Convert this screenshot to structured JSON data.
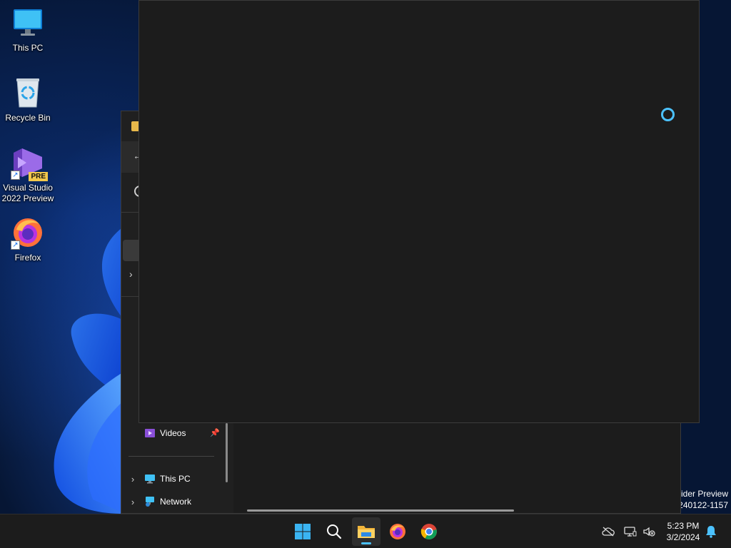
{
  "desktop": {
    "icons": [
      {
        "label": "This PC",
        "icon": "monitor-icon"
      },
      {
        "label": "Recycle Bin",
        "icon": "recycle-bin-icon"
      },
      {
        "label": "Visual Studio\n2022 Preview",
        "icon": "visual-studio-icon",
        "badge": "PRE"
      },
      {
        "label": "Firefox",
        "icon": "firefox-icon"
      }
    ],
    "watermark": {
      "line1": "Insider Preview",
      "line2": "240122-1157"
    }
  },
  "explorer": {
    "nav": {
      "videos": "Videos",
      "this_pc": "This PC",
      "network": "Network"
    }
  },
  "app_window": {
    "loading_indicator": "spinner-icon"
  },
  "taskbar": {
    "apps": [
      "start-icon",
      "search-icon",
      "file-explorer-icon",
      "firefox-icon",
      "chrome-icon"
    ],
    "active_app": "file-explorer-icon",
    "tray": [
      "cloud-off-icon",
      "network-icon",
      "volume-muted-icon",
      "notifications-bell-icon"
    ],
    "clock": {
      "time": "5:23 PM",
      "date": "3/2/2024"
    }
  },
  "colors": {
    "accent": "#4cc2ff",
    "window_bg": "#1c1c1c",
    "taskbar_bg": "#1c1c1c"
  }
}
